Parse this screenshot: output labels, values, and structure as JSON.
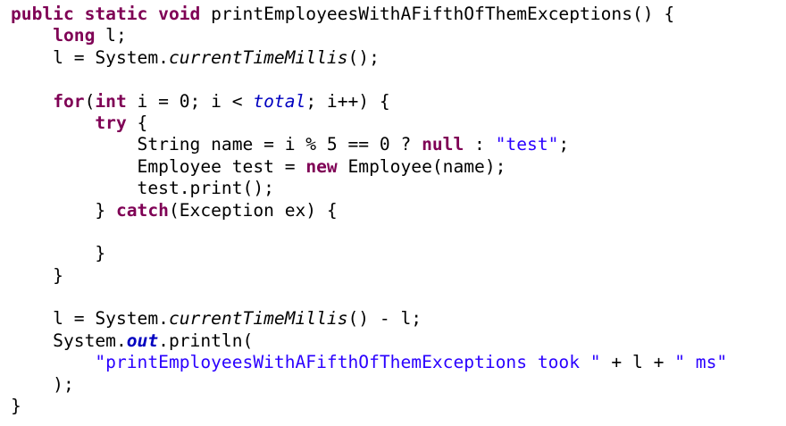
{
  "colors": {
    "background": "#ffffff",
    "keyword": "#7f0055",
    "string": "#2a00ff",
    "field": "#0000c0",
    "text": "#000000"
  },
  "code": {
    "lines": [
      [
        {
          "t": "public static void",
          "c": "kw"
        },
        {
          "t": " printEmployeesWithAFifthOfThemExceptions() {",
          "c": "plain"
        }
      ],
      [
        {
          "t": "    ",
          "c": "plain"
        },
        {
          "t": "long",
          "c": "kw"
        },
        {
          "t": " l;",
          "c": "plain"
        }
      ],
      [
        {
          "t": "    l = System.",
          "c": "plain"
        },
        {
          "t": "currentTimeMillis",
          "c": "static-call"
        },
        {
          "t": "();",
          "c": "plain"
        }
      ],
      [],
      [
        {
          "t": "    ",
          "c": "plain"
        },
        {
          "t": "for",
          "c": "kw"
        },
        {
          "t": "(",
          "c": "plain"
        },
        {
          "t": "int",
          "c": "kw"
        },
        {
          "t": " i = 0; i < ",
          "c": "plain"
        },
        {
          "t": "total",
          "c": "field"
        },
        {
          "t": "; i++) {",
          "c": "plain"
        }
      ],
      [
        {
          "t": "        ",
          "c": "plain"
        },
        {
          "t": "try",
          "c": "kw"
        },
        {
          "t": " {",
          "c": "plain"
        }
      ],
      [
        {
          "t": "            String name = i % 5 == 0 ? ",
          "c": "plain"
        },
        {
          "t": "null",
          "c": "kw"
        },
        {
          "t": " : ",
          "c": "plain"
        },
        {
          "t": "\"test\"",
          "c": "str"
        },
        {
          "t": ";",
          "c": "plain"
        }
      ],
      [
        {
          "t": "            Employee test = ",
          "c": "plain"
        },
        {
          "t": "new",
          "c": "kw"
        },
        {
          "t": " Employee(name);",
          "c": "plain"
        }
      ],
      [
        {
          "t": "            test.print();",
          "c": "plain"
        }
      ],
      [
        {
          "t": "        } ",
          "c": "plain"
        },
        {
          "t": "catch",
          "c": "kw"
        },
        {
          "t": "(Exception ex) {",
          "c": "plain"
        }
      ],
      [],
      [
        {
          "t": "        }",
          "c": "plain"
        }
      ],
      [
        {
          "t": "    }",
          "c": "plain"
        }
      ],
      [],
      [
        {
          "t": "    l = System.",
          "c": "plain"
        },
        {
          "t": "currentTimeMillis",
          "c": "static-call"
        },
        {
          "t": "() - l;",
          "c": "plain"
        }
      ],
      [
        {
          "t": "    System.",
          "c": "plain"
        },
        {
          "t": "out",
          "c": "field-bold"
        },
        {
          "t": ".println(",
          "c": "plain"
        }
      ],
      [
        {
          "t": "        ",
          "c": "plain"
        },
        {
          "t": "\"printEmployeesWithAFifthOfThemExceptions took \"",
          "c": "str"
        },
        {
          "t": " + l + ",
          "c": "plain"
        },
        {
          "t": "\" ms\"",
          "c": "str"
        }
      ],
      [
        {
          "t": "    );",
          "c": "plain"
        }
      ],
      [
        {
          "t": "}",
          "c": "plain"
        }
      ]
    ]
  }
}
